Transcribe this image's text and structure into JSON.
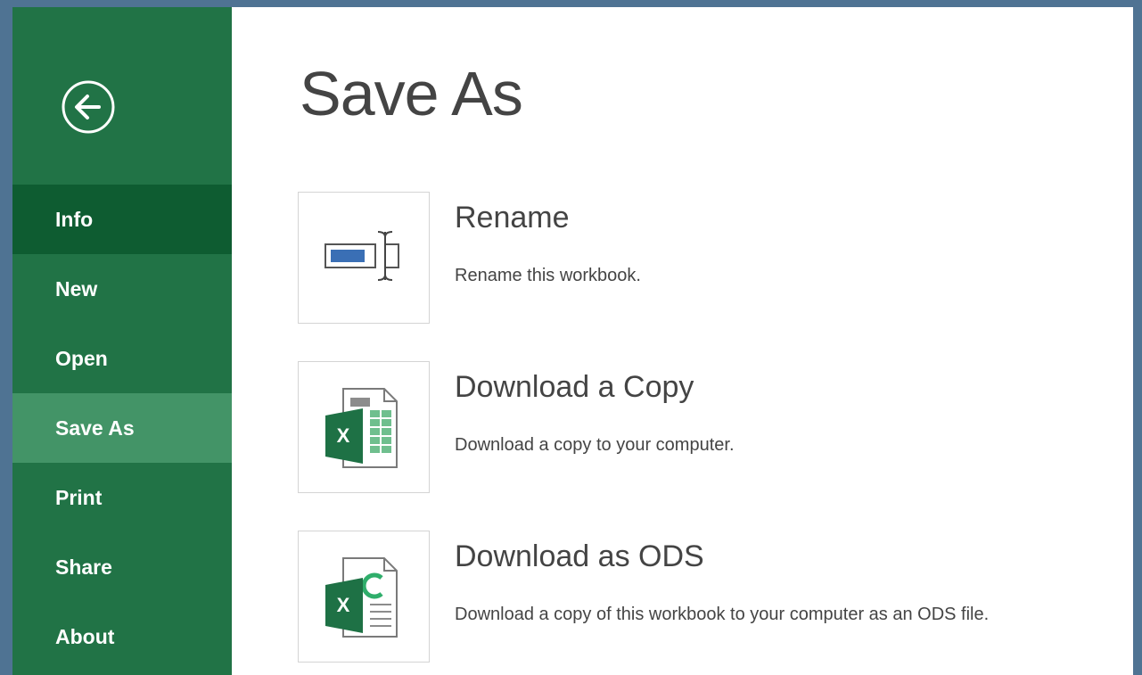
{
  "sidebar": {
    "back_label": "",
    "items": [
      {
        "label": "Info"
      },
      {
        "label": "New"
      },
      {
        "label": "Open"
      },
      {
        "label": "Save As"
      },
      {
        "label": "Print"
      },
      {
        "label": "Share"
      },
      {
        "label": "About"
      }
    ],
    "selected": "Save As"
  },
  "main": {
    "title": "Save As",
    "options": [
      {
        "title": "Rename",
        "description": "Rename this workbook.",
        "icon": "rename-icon"
      },
      {
        "title": "Download a Copy",
        "description": "Download a copy to your computer.",
        "icon": "excel-workbook-icon"
      },
      {
        "title": "Download as ODS",
        "description": "Download a copy of this workbook to your computer as an ODS file.",
        "icon": "excel-ods-icon"
      }
    ]
  },
  "colors": {
    "sidebar": "#217346",
    "sidebar_info": "#0e5c31",
    "sidebar_selected": "#439467",
    "excel_green": "#1e7145",
    "accent_blue": "#3a6fb5",
    "frame": "#4f7393"
  }
}
